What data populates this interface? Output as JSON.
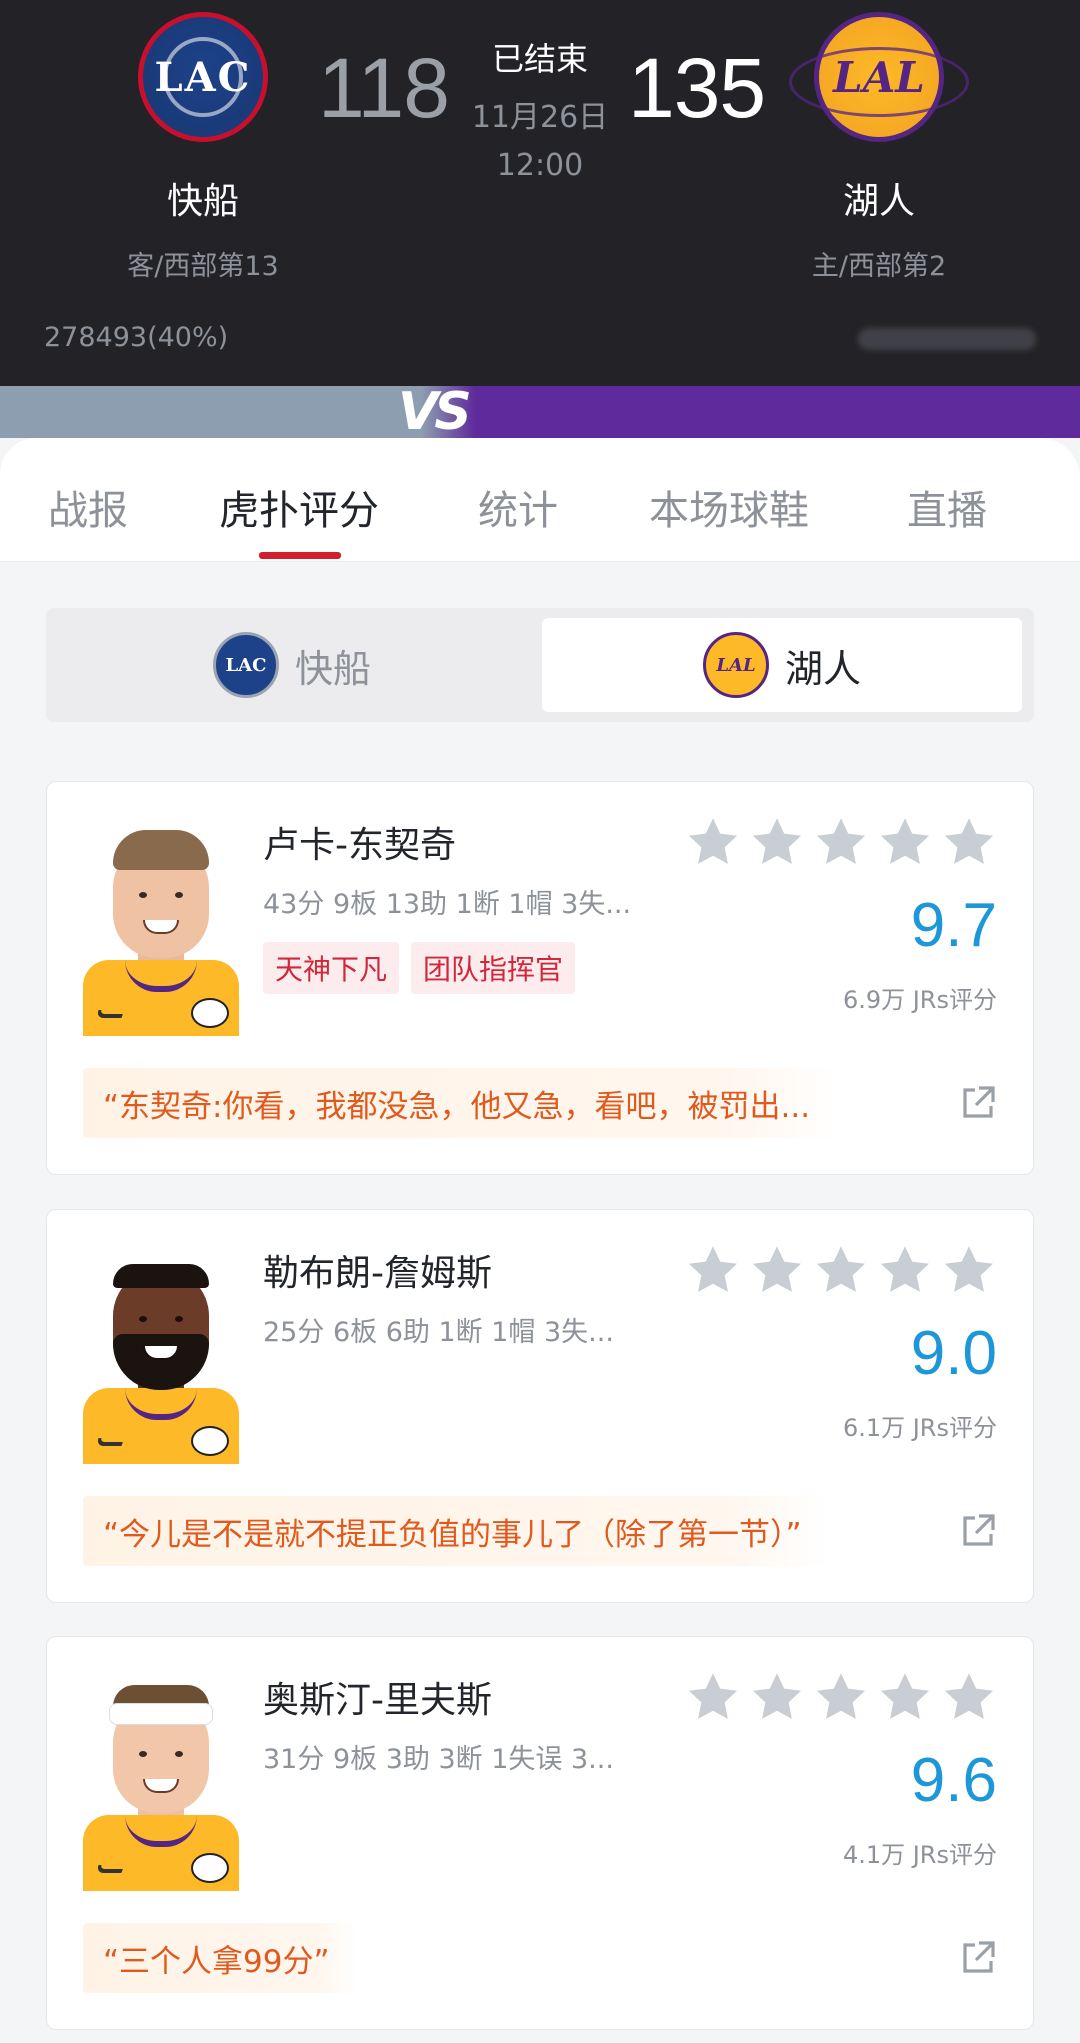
{
  "header": {
    "status": "已结束",
    "date": "11月26日",
    "time": "12:00",
    "away": {
      "logo": "LAC",
      "name": "快船",
      "score": "118",
      "rank": "客/西部第13",
      "support": "278493(40%)"
    },
    "home": {
      "logo": "LAL",
      "name": "湖人",
      "score": "135",
      "rank": "主/西部第2"
    },
    "vs": "VS",
    "colors": {
      "away": "#8e9eb1",
      "home": "#5f2a9b",
      "background": "#232327"
    }
  },
  "tabs": [
    {
      "label": "战报",
      "active": false
    },
    {
      "label": "虎扑评分",
      "active": true
    },
    {
      "label": "统计",
      "active": false
    },
    {
      "label": "本场球鞋",
      "active": false
    },
    {
      "label": "直播",
      "active": false
    }
  ],
  "team_switch": {
    "away": {
      "logo": "LAC",
      "label": "快船",
      "selected": false
    },
    "home": {
      "logo": "LAL",
      "label": "湖人",
      "selected": true
    }
  },
  "players": [
    {
      "name": "卢卡-东契奇",
      "stats": "43分 9板 13助 1断 1帽 3失...",
      "tags": [
        "天神下凡",
        "团队指挥官"
      ],
      "rating": "9.7",
      "votes": "6.9万 JRs评分",
      "quote": "“东契奇:你看，我都没急，他又急，看吧，被罚出...",
      "avatar": "luka-avatar"
    },
    {
      "name": "勒布朗-詹姆斯",
      "stats": "25分 6板 6助 1断 1帽 3失...",
      "tags": [],
      "rating": "9.0",
      "votes": "6.1万 JRs评分",
      "quote": "“今儿是不是就不提正负值的事儿了（除了第一节）”",
      "avatar": "lebron-avatar"
    },
    {
      "name": "奥斯汀-里夫斯",
      "stats": "31分 9板 3助 3断 1失误 3...",
      "tags": [],
      "rating": "9.6",
      "votes": "4.1万 JRs评分",
      "quote": "“三个人拿99分”",
      "avatar": "reaves-avatar"
    }
  ],
  "colors": {
    "accent": "#d21f2d",
    "rating": "#1e97d8",
    "quote": "#e05a1e",
    "star": "#c9cdd4"
  }
}
